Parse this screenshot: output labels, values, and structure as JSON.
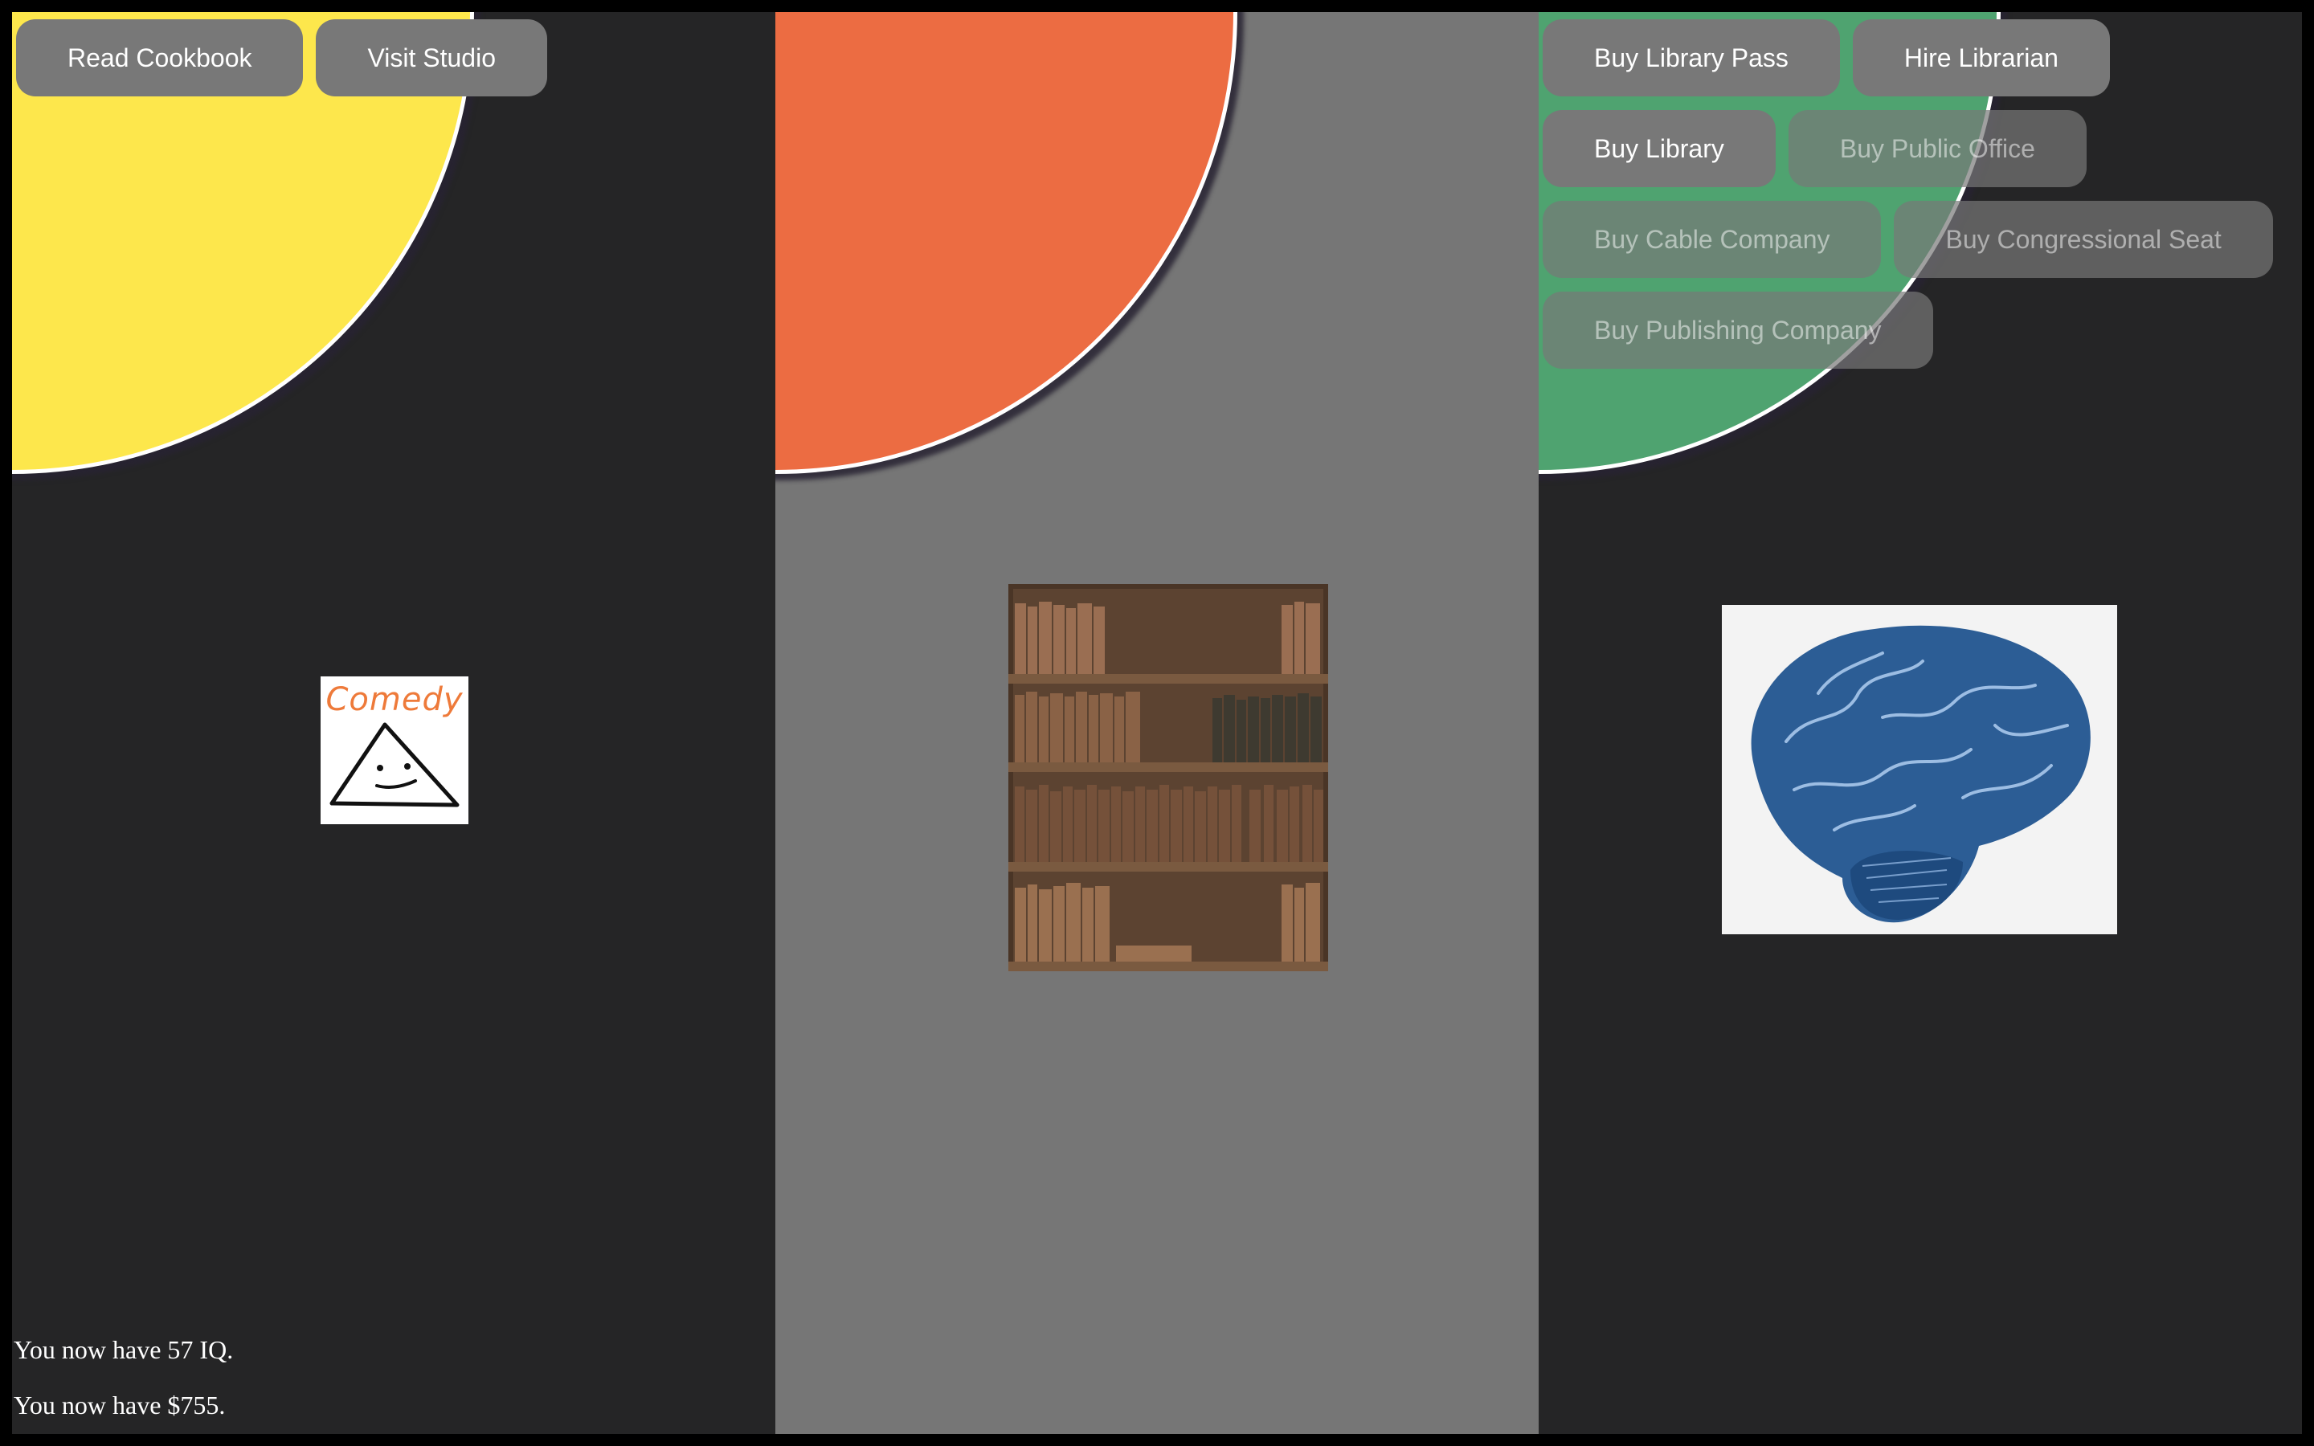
{
  "colors": {
    "panel_dark": "#252526",
    "panel_mid": "#767676",
    "circle_yellow": "#fde74c",
    "circle_orange": "#ec6c42",
    "circle_green": "#4fa370",
    "button_bg": "#787878"
  },
  "left_panel": {
    "buttons": {
      "read_cookbook": "Read Cookbook",
      "visit_studio": "Visit Studio"
    },
    "image": {
      "name": "comedy-drawing",
      "text": "Comedy"
    }
  },
  "middle_panel": {
    "image": {
      "name": "bookshelf-photo"
    }
  },
  "right_panel": {
    "buttons": {
      "buy_library_pass": "Buy Library Pass",
      "hire_librarian": "Hire Librarian",
      "buy_library": "Buy Library",
      "buy_public_office": "Buy Public Office",
      "buy_cable_company": "Buy Cable Company",
      "buy_congressional_seat": "Buy Congressional Seat",
      "buy_publishing_company": "Buy Publishing Company"
    },
    "image": {
      "name": "brain-illustration"
    }
  },
  "status": {
    "iq_text": "You now have 57 IQ.",
    "money_text": "You now have $755."
  }
}
